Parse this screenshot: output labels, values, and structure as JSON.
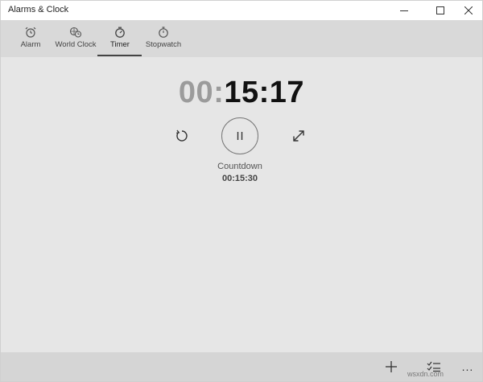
{
  "window": {
    "title": "Alarms & Clock",
    "caption_buttons": [
      "minimize-icon",
      "maximize-icon",
      "close-icon"
    ]
  },
  "tabs": [
    {
      "label": "Alarm",
      "icon": "alarm-clock-icon"
    },
    {
      "label": "World Clock",
      "icon": "world-clock-icon"
    },
    {
      "label": "Timer",
      "icon": "timer-icon",
      "active": true
    },
    {
      "label": "Stopwatch",
      "icon": "stopwatch-icon"
    }
  ],
  "timer": {
    "minutes_hours_prefix": "00",
    "sep1": ":",
    "minutes": "15",
    "sep2": ":",
    "seconds": "17",
    "countdown_label": "Countdown",
    "countdown_total": "00:15:30",
    "controls": [
      "reset-icon",
      "pause-icon",
      "expand-icon"
    ]
  },
  "command_bar": {
    "items": [
      "add-icon",
      "select-list-icon"
    ],
    "more": "..."
  },
  "watermark": "wsxdn.com",
  "colors": {
    "background": "#e6e6e6",
    "tabbar": "#d9d9d9",
    "command_bar": "#d5d5d5",
    "dim_digits": "#9b9b9b",
    "active_digits": "#111111"
  }
}
